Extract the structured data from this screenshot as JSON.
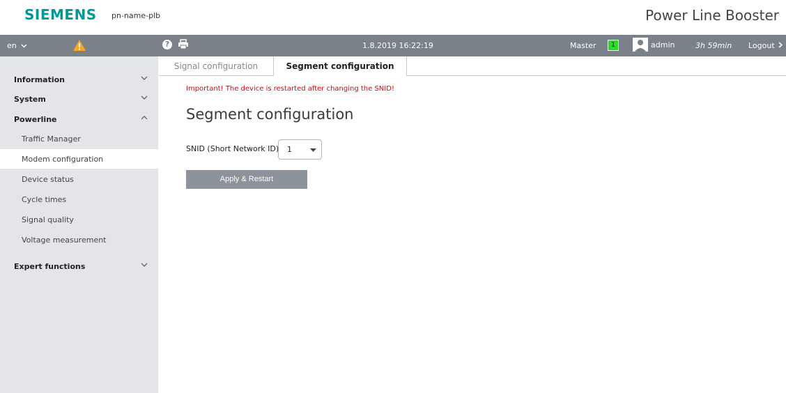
{
  "brand": {
    "logo": "SIEMENS",
    "device_name": "pn-name-plb",
    "product_title": "Power Line Booster"
  },
  "toolbar": {
    "language": "en",
    "warning_icon": "warning-icon",
    "help_icon": "help-icon",
    "print_icon": "printer-icon",
    "datetime": "1.8.2019 16:22:19",
    "role": "Master",
    "master_badge": "1",
    "master_badge_color": "#22e022",
    "user": "admin",
    "session_time": "3h 59min",
    "logout": "Logout",
    "bar_color": "#7a8189"
  },
  "sidebar": {
    "items": [
      {
        "label": "Information",
        "level": "top",
        "expanded": false
      },
      {
        "label": "System",
        "level": "top",
        "expanded": false
      },
      {
        "label": "Powerline",
        "level": "top",
        "expanded": true
      },
      {
        "label": "Traffic Manager",
        "level": "sub"
      },
      {
        "label": "Modem configuration",
        "level": "sub",
        "active": true
      },
      {
        "label": "Device status",
        "level": "sub"
      },
      {
        "label": "Cycle times",
        "level": "sub"
      },
      {
        "label": "Signal quality",
        "level": "sub"
      },
      {
        "label": "Voltage measurement",
        "level": "sub"
      },
      {
        "label": "Expert functions",
        "level": "top",
        "expanded": false
      }
    ]
  },
  "main": {
    "tabs": [
      {
        "label": "Signal configuration",
        "active": false
      },
      {
        "label": "Segment configuration",
        "active": true
      }
    ],
    "warning": "Important! The device is restarted after changing the SNID!",
    "warning_color": "#e4000c",
    "title": "Segment configuration",
    "snid_label": "SNID (Short Network ID):",
    "snid_value": "1",
    "apply_button": "Apply & Restart"
  }
}
